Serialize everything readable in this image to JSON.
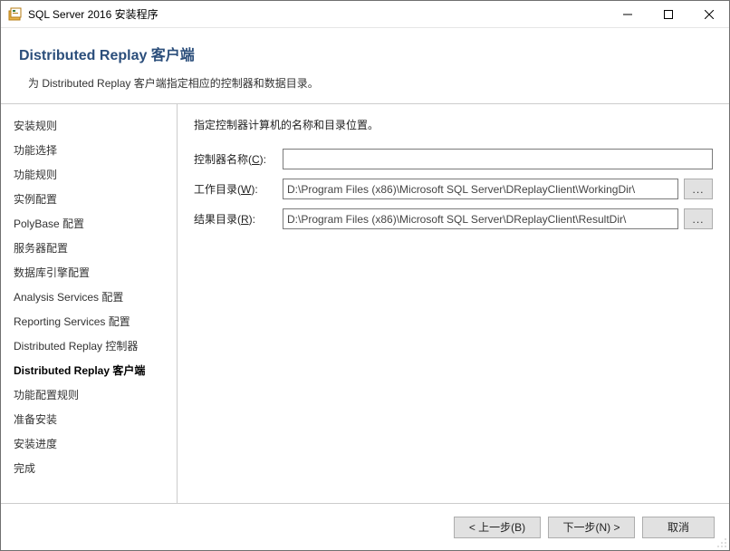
{
  "titlebar": {
    "title": "SQL Server 2016 安装程序"
  },
  "header": {
    "title": "Distributed  Replay 客户端",
    "subtitle": "为 Distributed Replay 客户端指定相应的控制器和数据目录。"
  },
  "sidebar": {
    "items": [
      {
        "label": "安装规则"
      },
      {
        "label": "功能选择"
      },
      {
        "label": "功能规则"
      },
      {
        "label": "实例配置"
      },
      {
        "label": "PolyBase 配置"
      },
      {
        "label": "服务器配置"
      },
      {
        "label": "数据库引擎配置"
      },
      {
        "label": "Analysis Services 配置"
      },
      {
        "label": "Reporting Services 配置"
      },
      {
        "label": "Distributed Replay 控制器"
      },
      {
        "label": "Distributed Replay 客户端"
      },
      {
        "label": "功能配置规则"
      },
      {
        "label": "准备安装"
      },
      {
        "label": "安装进度"
      },
      {
        "label": "完成"
      }
    ],
    "current_index": 10
  },
  "main": {
    "instruction": "指定控制器计算机的名称和目录位置。",
    "fields": {
      "controller": {
        "label_pre": "控制器名称(",
        "label_u": "C",
        "label_post": "):",
        "value": ""
      },
      "workdir": {
        "label_pre": "工作目录(",
        "label_u": "W",
        "label_post": "):",
        "value": "D:\\Program Files (x86)\\Microsoft SQL Server\\DReplayClient\\WorkingDir\\"
      },
      "resultdir": {
        "label_pre": "结果目录(",
        "label_u": "R",
        "label_post": "):",
        "value": "D:\\Program Files (x86)\\Microsoft SQL Server\\DReplayClient\\ResultDir\\"
      }
    },
    "browse_label": "..."
  },
  "footer": {
    "back": "< 上一步(B)",
    "next": "下一步(N) >",
    "cancel": "取消"
  }
}
